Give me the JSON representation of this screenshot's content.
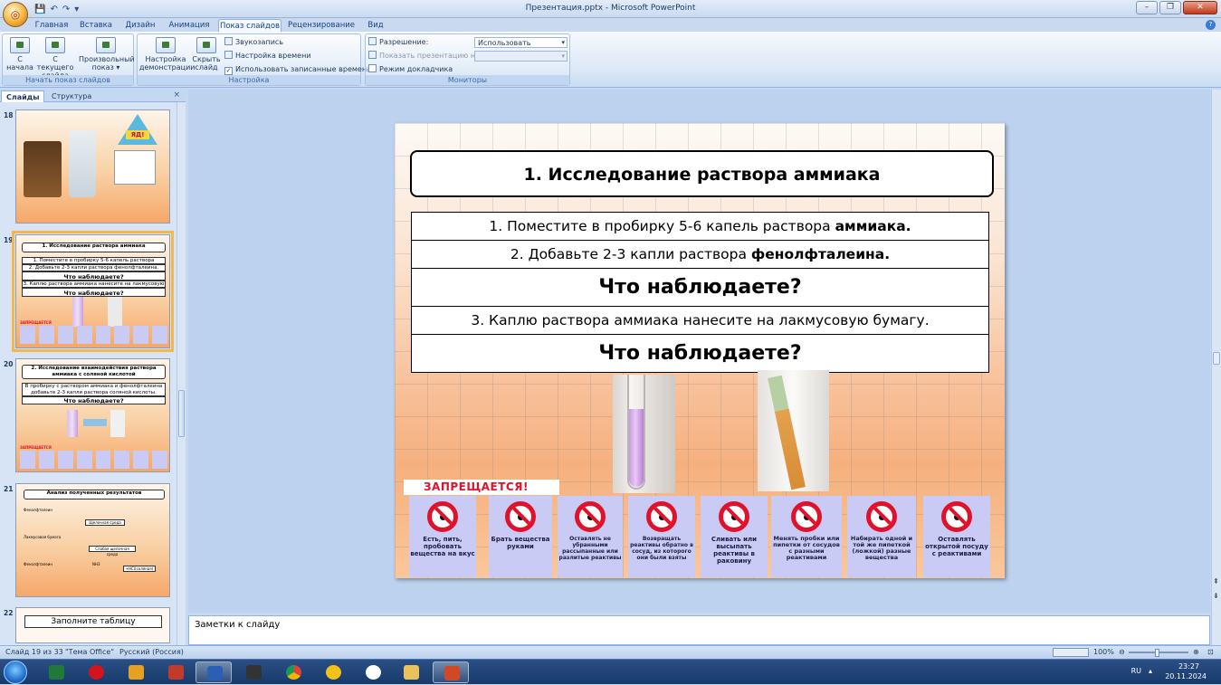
{
  "window": {
    "title": "Презентация.pptx - Microsoft PowerPoint",
    "qat_icons": [
      "save-icon",
      "undo-icon",
      "redo-icon",
      "customize-icon"
    ]
  },
  "tabs": [
    "Главная",
    "Вставка",
    "Дизайн",
    "Анимация",
    "Показ слайдов",
    "Рецензирование",
    "Вид"
  ],
  "active_tab": "Показ слайдов",
  "ribbon": {
    "group_start": {
      "label": "Начать показ слайдов",
      "from_start_1": "С",
      "from_start_2": "начала",
      "from_current_1": "С текущего",
      "from_current_2": "слайда",
      "custom_1": "Произвольный",
      "custom_2": "показ ▾"
    },
    "group_setup": {
      "label": "Настройка",
      "setup_1": "Настройка",
      "setup_2": "демонстрации",
      "hide_1": "Скрыть",
      "hide_2": "слайд",
      "record": "Звукозапись",
      "timing": "Настройка времени",
      "use_timing": "Использовать записанные времена"
    },
    "group_monitors": {
      "label": "Мониторы",
      "resolution": "Разрешение:",
      "resolution_value": "Использовать текуще...",
      "show_on": "Показать презентацию на:",
      "presenter": "Режим докладчика"
    }
  },
  "panel": {
    "tab_slides": "Слайды",
    "tab_outline": "Структура",
    "close": "×",
    "thumbnails": [
      {
        "num": "18",
        "label": "ЯД!"
      },
      {
        "num": "19",
        "title": "1. Исследование раствора аммиака",
        "l1": "1. Поместите в пробирку 5-6 капель раствора аммиака.",
        "l2": "2. Добавьте 2-3 капли раствора фенолфталеина.",
        "l3": "Что наблюдаете?",
        "l4": "3. Каплю раствора аммиака нанесите на лакмусовую бумагу.",
        "l5": "Что наблюдаете?",
        "forbid": "ЗАПРЕЩАЕТСЯ"
      },
      {
        "num": "20",
        "title": "2. Исследование взаимодействия раствора аммиака с соляной кислотой",
        "l1": "В пробирку с раствором аммиака и фенолфталеина добавьте 2-3 капли раствора соляной кислоты.",
        "l2": "Что наблюдаете?",
        "forbid": "ЗАПРЕЩАЕТСЯ"
      },
      {
        "num": "21",
        "title": "Анализ полученных результатов",
        "a": "Фенолфталеин",
        "b": "Щелочная среда",
        "c": "Лакмусовая бумага",
        "d": "Слабая щелочная среда",
        "e": "Фенолфталеин",
        "f": "NH3",
        "g": "+HCl(соляная)"
      },
      {
        "num": "22",
        "title": "Заполните таблицу"
      }
    ]
  },
  "slide": {
    "title": "1. Исследование  раствора  аммиака",
    "row1_text": "1. Поместите в пробирку 5-6 капель раствора ",
    "row1_bold": "аммиака.",
    "row2_text": "2. Добавьте 2-3  капли  раствора ",
    "row2_bold": "фенолфталеина.",
    "row3": "Что наблюдаете?",
    "row4": "3. Каплю раствора аммиака нанесите на лакмусовую бумагу.",
    "row5": "Что наблюдаете?",
    "forbid_title": "ЗАПРЕЩАЕТСЯ!",
    "signs": [
      "Есть, пить, пробовать вещества на вкус",
      "Брать вещества руками",
      "Оставлять не убранными рассыпанные или разлитые реактивы",
      "Возвращать реактивы обратно в сосуд, из которого они были взяты",
      "Сливать или высыпать реактивы в раковину",
      "Менять пробки или пипетки от сосудов с разными реактивами",
      "Набирать одной и той же пипеткой (ложкой) разные вещества",
      "Оставлять открытой посуду с реактивами"
    ]
  },
  "notes_placeholder": "Заметки к слайду",
  "status": {
    "slide_counter": "Слайд 19 из 33",
    "theme": "\"Тема Office\"",
    "language": "Русский (Россия)",
    "zoom": "100%"
  },
  "taskbar": {
    "lang": "RU",
    "time": "23:27",
    "date": "20.11.2024"
  },
  "colors": {
    "accent_red": "#e0112b",
    "ribbon_blue": "#dbe8f7"
  }
}
